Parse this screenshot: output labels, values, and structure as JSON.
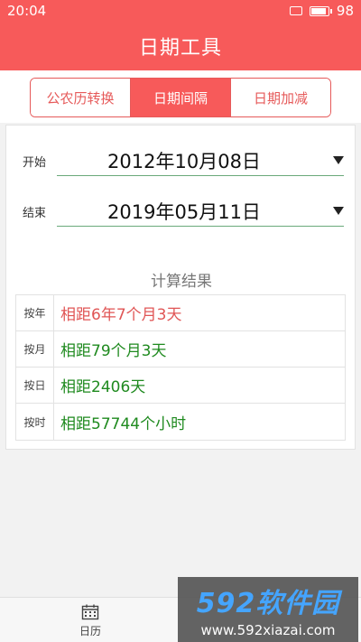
{
  "status": {
    "time": "20:04",
    "battery": "98"
  },
  "header": {
    "title": "日期工具"
  },
  "tabs": [
    {
      "label": "公农历转换",
      "active": false
    },
    {
      "label": "日期间隔",
      "active": true
    },
    {
      "label": "日期加减",
      "active": false
    }
  ],
  "form": {
    "start": {
      "label": "开始",
      "value": "2012年10月08日"
    },
    "end": {
      "label": "结束",
      "value": "2019年05月11日"
    }
  },
  "result": {
    "title": "计算结果",
    "rows": [
      {
        "label": "按年",
        "value": "相距6年7个月3天",
        "color": "#e05555"
      },
      {
        "label": "按月",
        "value": "相距79个月3天",
        "color": "#1f8a1f"
      },
      {
        "label": "按日",
        "value": "相距2406天",
        "color": "#1f8a1f"
      },
      {
        "label": "按时",
        "value": "相距57744个小时",
        "color": "#1f8a1f"
      }
    ]
  },
  "bottom_nav": [
    {
      "label": "日历",
      "icon": "calendar-icon"
    }
  ],
  "watermark": {
    "brand": "592软件园",
    "url": "www.592xiazai.com"
  },
  "colors": {
    "accent": "#f75a5a"
  }
}
